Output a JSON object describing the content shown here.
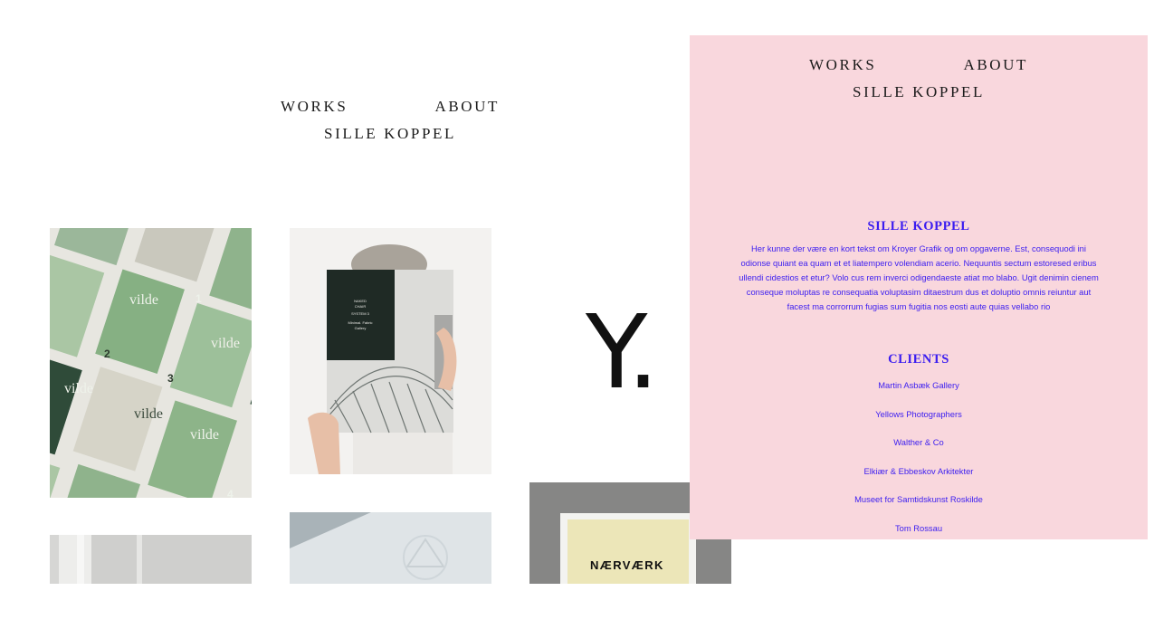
{
  "nav": {
    "works": "WORKS",
    "about": "ABOUT",
    "brand": "SILLE KOPPEL"
  },
  "gallery": {
    "books": {
      "cover_word": "vilde",
      "numbers": [
        "1",
        "2",
        "3",
        "4"
      ]
    },
    "magazine": {
      "cover_lines": [
        "NAKED",
        "CHAIR",
        "SYSTEM 3",
        "Minimal. Fabric",
        "Gallery"
      ]
    },
    "logo": {
      "mark": "Y."
    },
    "naervaerk": {
      "label": "NÆRVÆRK"
    }
  },
  "about": {
    "title": "SILLE KOPPEL",
    "text": "Her kunne der være en kort tekst om Kroyer Grafik og om opgaverne. Est, consequodi ini odionse quiant ea quam et et liatempero volendiam acerio. Nequuntis sectum estoresed eribus ullendi cidestios et etur? Volo cus rem inverci odigendaeste atiat mo blabo. Ugit denimin cienem conseque moluptas re consequatia voluptasim ditaestrum dus et doluptio omnis reiuntur aut facest ma corrorrum fugias sum fugitia nos eosti aute quias vellabo rio",
    "clients_title": "CLIENTS",
    "clients": [
      "Martin Asbæk Gallery",
      "Yellows Photographers",
      "Walther & Co",
      "Elkiær & Ebbeskov Arkitekter",
      "Museet for Samtidskunst Roskilde",
      "Tom Rossau"
    ]
  },
  "colors": {
    "overlay_bg": "#f9d7dd",
    "accent_text": "#3b1df0",
    "nav_text": "#1a1a1a"
  }
}
